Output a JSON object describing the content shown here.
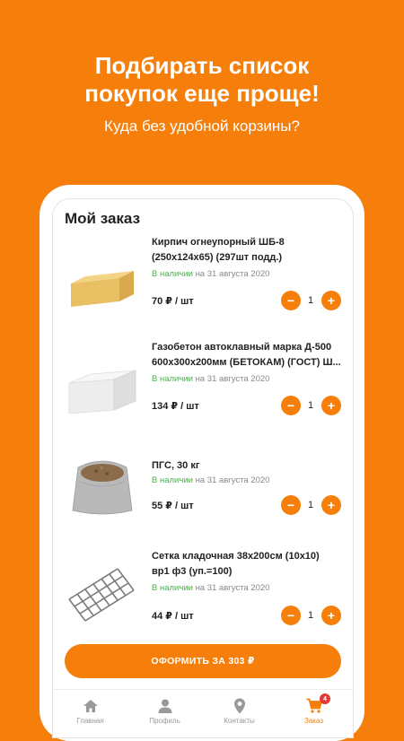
{
  "promo": {
    "title_line1": "Подбирать список",
    "title_line2": "покупок еще проще!",
    "subtitle": "Куда без удобной корзины?"
  },
  "screen": {
    "title": "Мой заказ",
    "items": [
      {
        "name_line1": "Кирпич огнеупорный ШБ-8",
        "name_line2": "(250х124х65) (297шт подд.)",
        "stock_status": "В наличии",
        "stock_date": "на 31 августа 2020",
        "price": "70 ₽ / шт",
        "quantity": "1",
        "image_icon": "refractory-brick-image"
      },
      {
        "name_line1": "Газобетон автоклавный марка Д-500",
        "name_line2": "600х300х200мм (БЕТОКАМ) (ГОСТ) Ш...",
        "stock_status": "В наличии",
        "stock_date": "на 31 августа 2020",
        "price": "134 ₽ / шт",
        "quantity": "1",
        "image_icon": "aerated-concrete-block-image"
      },
      {
        "name_line1": "ПГС, 30 кг",
        "name_line2": "",
        "stock_status": "В наличии",
        "stock_date": "на 31 августа 2020",
        "price": "55 ₽ / шт",
        "quantity": "1",
        "image_icon": "sand-gravel-bag-image"
      },
      {
        "name_line1": "Сетка кладочная 38х200см (10х10)",
        "name_line2": "вр1 ф3 (уп.=100)",
        "stock_status": "В наличии",
        "stock_date": "на 31 августа 2020",
        "price": "44 ₽ / шт",
        "quantity": "1",
        "image_icon": "masonry-mesh-image"
      }
    ],
    "minus_symbol": "−",
    "plus_symbol": "+",
    "checkout_label": "ОФОРМИТЬ ЗА 303 ₽"
  },
  "nav": {
    "items": [
      {
        "label": "Главная",
        "icon": "home-icon"
      },
      {
        "label": "Профиль",
        "icon": "person-icon"
      },
      {
        "label": "Контакты",
        "icon": "location-pin-icon"
      },
      {
        "label": "Заказ",
        "icon": "cart-icon",
        "badge": "4",
        "active": true
      }
    ]
  },
  "colors": {
    "brand_orange": "#F57F0A",
    "in_stock_green": "#4CAF50",
    "badge_red": "#e53935"
  }
}
